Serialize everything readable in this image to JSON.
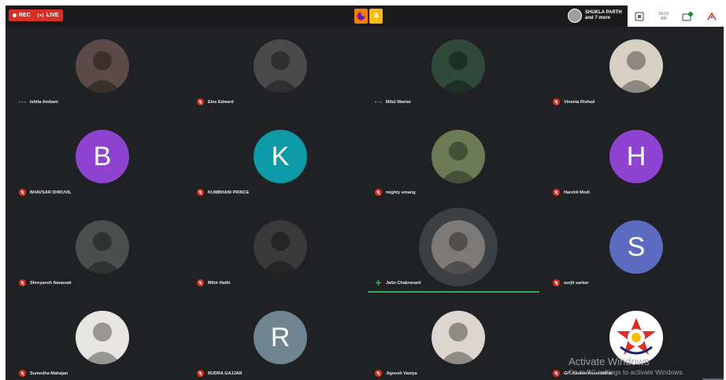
{
  "topbar": {
    "rec_label": "REC",
    "live_label": "LIVE",
    "presenter_name": "SHUKLA PARTH",
    "presenter_more": "and 7 more",
    "time_small": "09:15 AM"
  },
  "participants": [
    {
      "name": "Ishita Ambani",
      "avatar": "photo",
      "muted": false,
      "bg": "#5b4a48"
    },
    {
      "name": "Eles Edward",
      "avatar": "photo",
      "muted": true,
      "bg": "#4a4a4a"
    },
    {
      "name": "Mitul Maniar",
      "avatar": "photo",
      "muted": false,
      "bg": "#2f4a3a"
    },
    {
      "name": "Vineeta Rishad",
      "avatar": "photo",
      "muted": true,
      "bg": "#d8cfc3"
    },
    {
      "name": "BHAVSAR DHRUVIL",
      "avatar": "letter",
      "letter": "B",
      "muted": true,
      "bg": "#8e44d0"
    },
    {
      "name": "KUMBHANI PRINCE",
      "avatar": "letter",
      "letter": "K",
      "muted": true,
      "bg": "#0f9aa8"
    },
    {
      "name": "mighty umang",
      "avatar": "photo",
      "muted": true,
      "bg": "#6c7a56"
    },
    {
      "name": "Harshil Modi",
      "avatar": "letter",
      "letter": "H",
      "muted": true,
      "bg": "#8e44d0"
    },
    {
      "name": "Shreyansh Nanavati",
      "avatar": "photo",
      "muted": true,
      "bg": "#4b4f4d"
    },
    {
      "name": "Mihir Hathi",
      "avatar": "photo",
      "muted": true,
      "bg": "#3a3a3a"
    },
    {
      "name": "Jatin Chakravarti",
      "avatar": "photo",
      "muted": false,
      "speaking": true,
      "bg": "#7c7a79"
    },
    {
      "name": "surjit sarkar",
      "avatar": "letter",
      "letter": "S",
      "muted": true,
      "bg": "#5c6bc0"
    },
    {
      "name": "Sumedha Mahajan",
      "avatar": "photo",
      "muted": true,
      "bg": "#e8e6e2"
    },
    {
      "name": "RUDRA GAJJAR",
      "avatar": "letter",
      "letter": "R",
      "muted": true,
      "bg": "#6f8592"
    },
    {
      "name": "Jignesh Vaniya",
      "avatar": "photo",
      "muted": true,
      "bg": "#dcd6cf"
    },
    {
      "name": "GIT Alumni Association",
      "avatar": "logo",
      "muted": true,
      "bg": "#ffffff"
    }
  ],
  "watermark": {
    "title": "Activate Windows",
    "subtitle": "Go to PC settings to activate Windows."
  },
  "colors": {
    "muted": "#d93025",
    "speaking": "#34a853",
    "rec": "#d93025"
  }
}
